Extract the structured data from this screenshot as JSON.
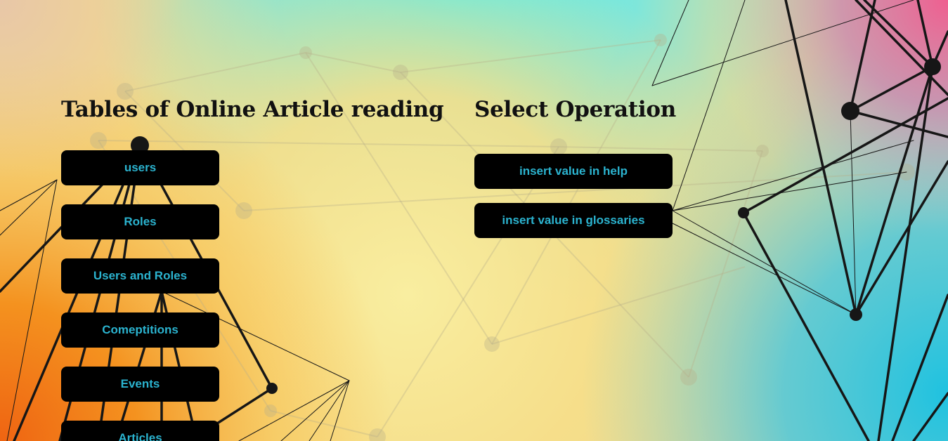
{
  "headings": {
    "tables": "Tables of Online Article reading",
    "operations": "Select Operation"
  },
  "tables": [
    {
      "label": "users"
    },
    {
      "label": "Roles"
    },
    {
      "label": "Users and Roles"
    },
    {
      "label": "Comeptitions"
    },
    {
      "label": "Events"
    },
    {
      "label": "Articles"
    }
  ],
  "operations": [
    {
      "label": "insert value in help"
    },
    {
      "label": "insert value in glossaries"
    }
  ],
  "colors": {
    "button_bg": "#000000",
    "button_text": "#2bb3cf",
    "heading": "#111111",
    "bg_cyan": "#4fe8ee",
    "bg_yellow": "#f8ec9c",
    "bg_orange": "#f17a1c",
    "bg_pink": "#e06a9a"
  }
}
